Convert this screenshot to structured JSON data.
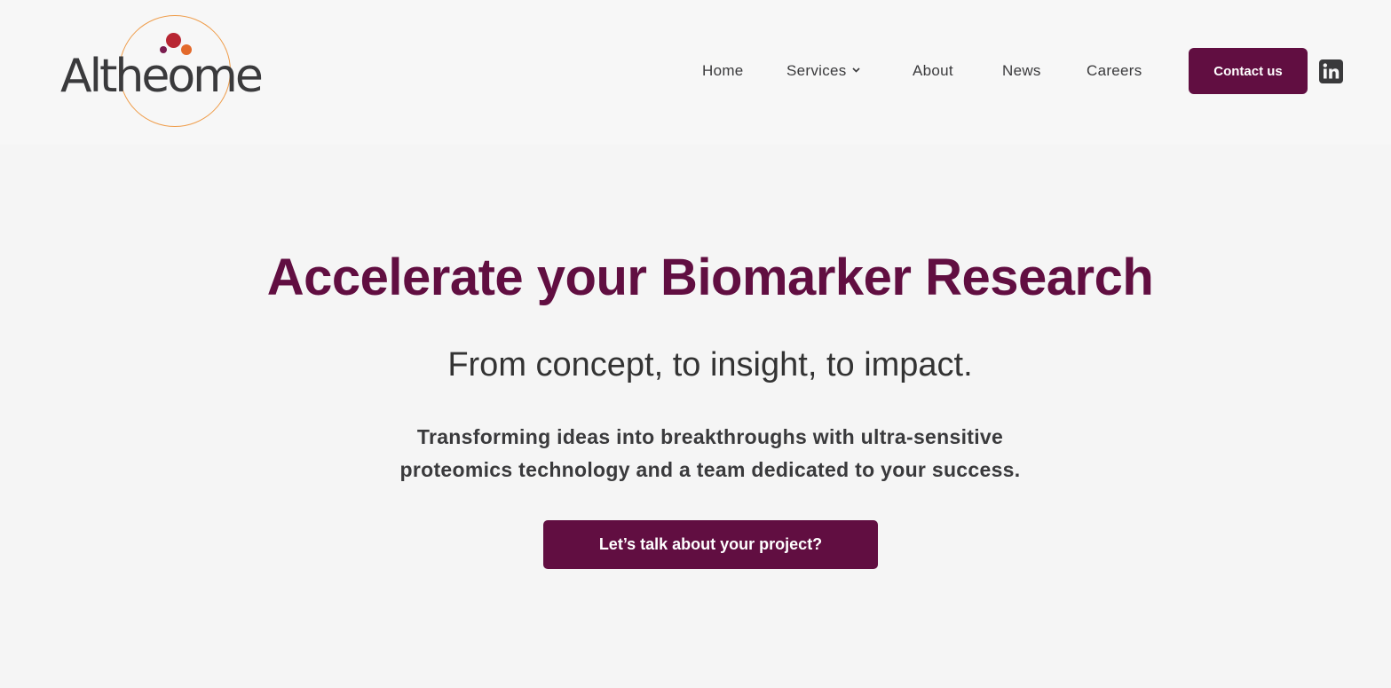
{
  "brand": {
    "name": "Altheome",
    "primary_color": "#610e41",
    "ring_color": "#ef9d4b",
    "dot_colors": [
      "#b82633",
      "#e36a2c",
      "#7a1c4f"
    ]
  },
  "header": {
    "nav": [
      {
        "label": "Home"
      },
      {
        "label": "Services",
        "icon": "chevron-down-icon"
      },
      {
        "label": "About"
      },
      {
        "label": "News"
      },
      {
        "label": "Careers"
      }
    ],
    "contact_label": "Contact us",
    "social_icon": "linkedin-icon"
  },
  "hero": {
    "title": "Accelerate your Biomarker Research",
    "subtitle": "From concept, to insight, to impact.",
    "body_lines": [
      "Transforming ideas into breakthroughs with ultra-sensitive",
      "proteomics technology and a team dedicated to your success."
    ],
    "cta_label": "Let’s talk about your project?"
  }
}
